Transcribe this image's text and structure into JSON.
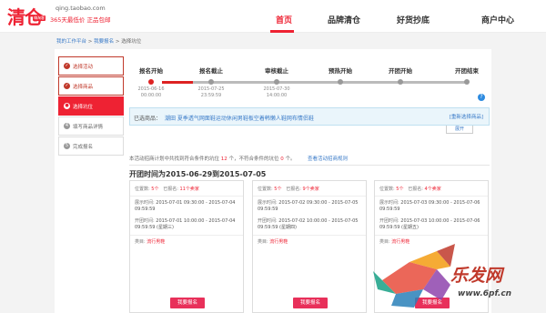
{
  "header": {
    "logo_text": "清仓",
    "logo_badge": "嗨淘客",
    "domain": "qing.taobao.com",
    "slogan": "365天最低价 正品包邮",
    "nav": [
      "首页",
      "品牌清仓",
      "好货抄底",
      "商户中心"
    ]
  },
  "breadcrumb": {
    "items": [
      "我的工作平台",
      "我要报名",
      "选择坑位"
    ],
    "separator": ">"
  },
  "steps": [
    {
      "label": "选择活动",
      "status": "done",
      "icon": "check-icon"
    },
    {
      "label": "选择商品",
      "status": "done",
      "icon": "check-icon"
    },
    {
      "label": "选择坑位",
      "status": "current",
      "icon": "dot-icon"
    },
    {
      "label": "填写商品详情",
      "status": "pending",
      "icon": "number-4"
    },
    {
      "label": "完成报名",
      "status": "pending",
      "icon": "number-5"
    }
  ],
  "timeline": [
    {
      "label": "报名开始",
      "date": "2015-06-16",
      "time": "00:00:00",
      "active": true
    },
    {
      "label": "报名截止",
      "date": "2015-07-25",
      "time": "23:59:59",
      "active": false
    },
    {
      "label": "审核截止",
      "date": "2015-07-30",
      "time": "14:00:00",
      "active": false
    },
    {
      "label": "预热开始",
      "date": "",
      "time": "",
      "active": false
    },
    {
      "label": "开团开始",
      "date": "",
      "time": "",
      "active": false
    },
    {
      "label": "开团结束",
      "date": "",
      "time": "",
      "active": false
    }
  ],
  "selected": {
    "label": "已选商品：",
    "value": "潮田 夏季透气网面鞋运动休闲男鞋板空着韩懒人鞋网布情侣鞋",
    "reselect": "[重新选择商品]",
    "expand": "展开"
  },
  "note": {
    "prefix": "本活动招商计划中共找到符合条件的坑位",
    "count_a": "12",
    "middle": "个，不符合条件的坑位",
    "count_b": "0",
    "suffix": "个。",
    "link": "查看活动招商规则"
  },
  "period_title": "开团时间为2015-06-29到2015-07-05",
  "cards": [
    {
      "positions_label": "位置数:",
      "positions": "5个",
      "registered_label": "已报名:",
      "registered": "11个卖家",
      "show_label": "展示时间:",
      "show_time": "2015-07-01 09:30:00 - 2015-07-04 09:59:59",
      "open_label": "开团时间:",
      "open_time": "2015-07-01 10:00:00 - 2015-07-04 09:59:59 (星期三)",
      "category_label": "类目:",
      "category": "流行男鞋",
      "button": "我要报名"
    },
    {
      "positions_label": "位置数:",
      "positions": "5个",
      "registered_label": "已报名:",
      "registered": "9个卖家",
      "show_label": "展示时间:",
      "show_time": "2015-07-02 09:30:00 - 2015-07-05 09:59:59",
      "open_label": "开团时间:",
      "open_time": "2015-07-02 10:00:00 - 2015-07-05 09:59:59 (星期四)",
      "category_label": "类目:",
      "category": "流行男鞋",
      "button": "我要报名"
    },
    {
      "positions_label": "位置数:",
      "positions": "5个",
      "registered_label": "已报名:",
      "registered": "4个卖家",
      "show_label": "展示时间:",
      "show_time": "2015-07-03 09:30:00 - 2015-07-06 09:59:59",
      "open_label": "开团时间:",
      "open_time": "2015-07-03 10:00:00 - 2015-07-06 09:59:59 (星期五)",
      "category_label": "类目:",
      "category": "流行男鞋",
      "button": "我要报名"
    }
  ],
  "watermark": {
    "brand": "乐发网",
    "url": "www.6pf.cn"
  },
  "colors": {
    "brand_red": "#e22233",
    "link_blue": "#3a7bc8",
    "button_pink": "#e8305a"
  }
}
